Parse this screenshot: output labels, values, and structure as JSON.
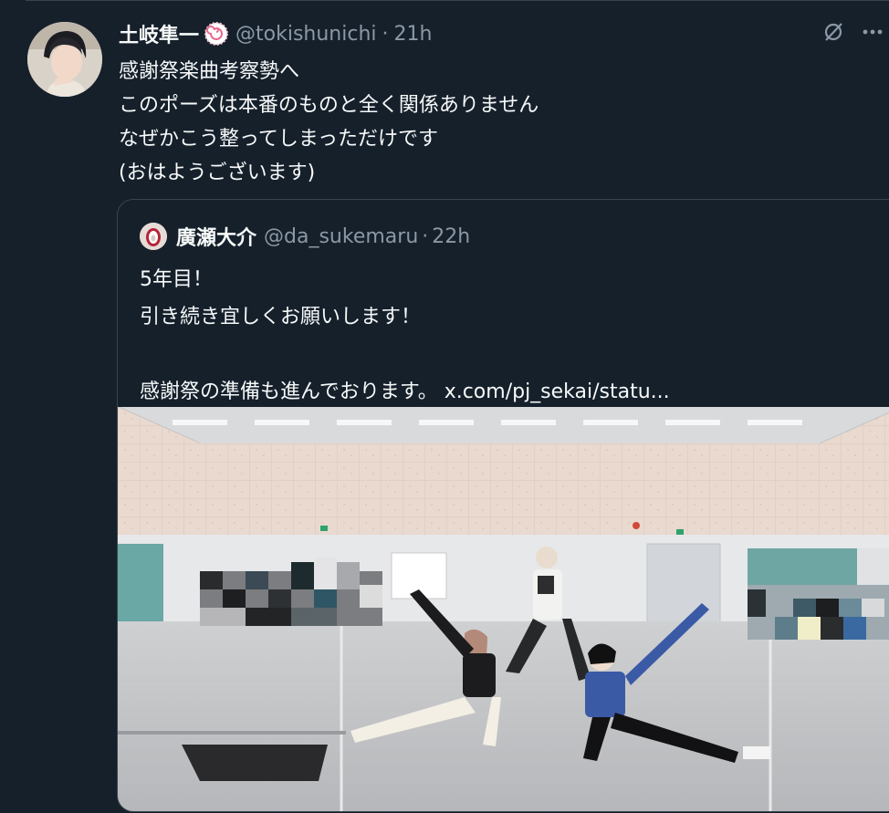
{
  "tweet": {
    "display_name": "土岐隼一",
    "handle": "@tokishunichi",
    "separator": "·",
    "time": "21h",
    "avatar_icon": "profile-avatar",
    "badge_icon": "narutomaki-emoji",
    "lines": [
      "感謝祭楽曲考察勢へ",
      "このポーズは本番のものと全く関係ありません",
      "なぜかこう整ってしまっただけです",
      "(おはようございます)"
    ],
    "actions": {
      "translate_icon": "translate-icon",
      "more_icon": "more-icon"
    }
  },
  "quote": {
    "display_name": "廣瀬大介",
    "handle": "@da_sukemaru",
    "separator": "·",
    "time": "22h",
    "avatar_icon": "egg-avatar",
    "lines": [
      "5年目！",
      "引き続き宜しくお願いします！",
      "",
      "感謝祭の準備も進んでおります。 x.com/pj_sekai/statu..."
    ],
    "media": {
      "kind": "photo",
      "description_icon": "rehearsal-photo"
    }
  },
  "colors": {
    "background": "#15202b",
    "border": "#38444d",
    "text_primary": "#f7f9f9",
    "text_secondary": "#8b98a5"
  }
}
